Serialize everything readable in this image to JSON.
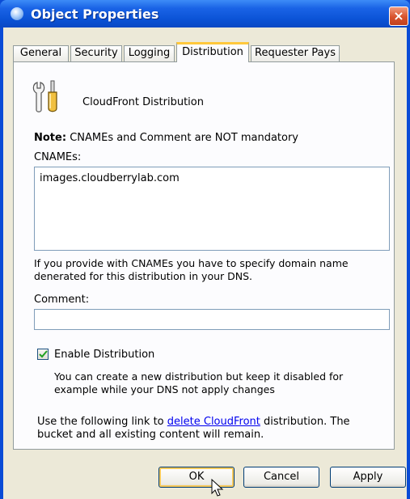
{
  "window": {
    "title": "Object Properties",
    "close_label": "×"
  },
  "tabs": [
    {
      "label": "General",
      "active": false
    },
    {
      "label": "Security",
      "active": false
    },
    {
      "label": "Logging",
      "active": false
    },
    {
      "label": "Distribution",
      "active": true
    },
    {
      "label": "Requester Pays",
      "active": false
    }
  ],
  "panel": {
    "section_title": "CloudFront Distribution",
    "note_label": "Note:",
    "note_text": "CNAMEs and Comment are NOT mandatory",
    "cnames_label": "CNAMEs:",
    "cnames_value": "images.cloudberrylab.com",
    "cnames_hint_line1": "If you provide with CNAMEs you have to specify domain name",
    "cnames_hint_line2": "denerated for this distribution in your DNS.",
    "comment_label": "Comment:",
    "comment_value": "",
    "enable_label": "Enable Distribution",
    "enable_checked": true,
    "enable_hint_line1": "You can create a new distribution but keep it disabled for",
    "enable_hint_line2": "example while your DNS not apply changes",
    "delete_prefix": "Use the following link to",
    "delete_link": "delete CloudFront",
    "delete_suffix": "distribution. The",
    "delete_line2": "bucket and all existing content will remain."
  },
  "buttons": {
    "ok": "OK",
    "cancel": "Cancel",
    "apply": "Apply"
  }
}
